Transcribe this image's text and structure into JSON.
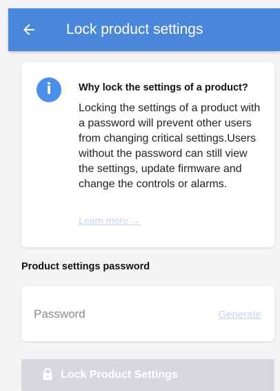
{
  "appbar": {
    "title": "Lock product settings",
    "back_icon": "arrow-left-icon"
  },
  "info_card": {
    "icon": "info-icon",
    "icon_glyph": "i",
    "title": "Why lock the settings of a product?",
    "body": "Locking the settings of a product with a password will prevent other users from changing critical settings.Users without the password can still view the settings, update firmware and change the controls or alarms.",
    "learn_more": "Learn more →"
  },
  "password_section": {
    "label": "Product settings password",
    "placeholder": "Password",
    "value": "",
    "generate_label": "Generate"
  },
  "lock_button": {
    "label": "Lock Product Settings",
    "icon": "lock-icon"
  },
  "colors": {
    "appbar": "#4a86d9",
    "info_icon": "#4a90e8",
    "link_disabled": "#c6d4f1",
    "button_disabled": "#d8d8dc",
    "background": "#f4f4f7"
  }
}
